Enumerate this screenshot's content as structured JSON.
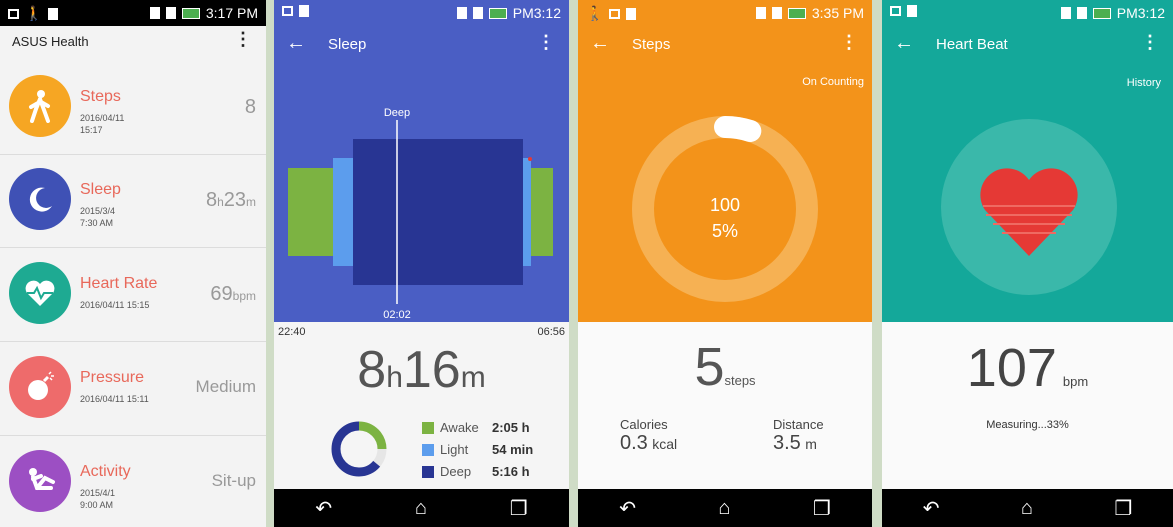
{
  "status": {
    "p1_time": "3:17 PM",
    "p2_time": "PM3:12",
    "p3_time": "3:35 PM",
    "p4_time": "PM3:12"
  },
  "home": {
    "title": "ASUS Health",
    "items": [
      {
        "name": "Steps",
        "date": "2016/04/11",
        "time": "15:17",
        "value": "8",
        "unit": "",
        "color": "#f6a623",
        "icon": "walking-icon"
      },
      {
        "name": "Sleep",
        "date": "2015/3/4",
        "time": "7:30 AM",
        "value": "8",
        "unit": "h",
        "value2": "23",
        "unit2": "m",
        "color": "#3f51b5",
        "icon": "moon-icon"
      },
      {
        "name": "Heart Rate",
        "date": "2016/04/11 15:15",
        "time": "",
        "value": "69",
        "unit": "bpm",
        "color": "#1eaa92",
        "icon": "heart-pulse-icon"
      },
      {
        "name": "Pressure",
        "date": "2016/04/11 15:11",
        "time": "",
        "value": "Medium",
        "unit": "",
        "color": "#ee6b6b",
        "icon": "bomb-icon"
      },
      {
        "name": "Activity",
        "date": "2015/4/1",
        "time": "9:00 AM",
        "value": "Sit-up",
        "unit": "",
        "color": "#9c4fc3",
        "icon": "situp-icon"
      }
    ]
  },
  "sleep": {
    "title": "Sleep",
    "marker_label": "Deep",
    "marker_time": "02:02",
    "start_time": "22:40",
    "end_time": "06:56",
    "total_hours": "8",
    "total_h_unit": "h",
    "total_minutes": "16",
    "total_m_unit": "m",
    "legend": [
      {
        "label": "Awake",
        "value": "2:05 h",
        "color": "#7cb342"
      },
      {
        "label": "Light",
        "value": "54 min",
        "color": "#5c9ded"
      },
      {
        "label": "Deep",
        "value": "5:16 h",
        "color": "#283593"
      }
    ],
    "donut": [
      {
        "label": "Awake",
        "fraction": 0.25,
        "color": "#7cb342"
      },
      {
        "label": "Light",
        "fraction": 0.11,
        "color": "#e6e6e6"
      },
      {
        "label": "Deep",
        "fraction": 0.64,
        "color": "#283593"
      }
    ]
  },
  "steps": {
    "title": "Steps",
    "status": "On Counting",
    "goal": "100",
    "percent": "5%",
    "progress": 0.05,
    "count": "5",
    "count_unit": "steps",
    "calories_label": "Calories",
    "calories_value": "0.3",
    "calories_unit": "kcal",
    "distance_label": "Distance",
    "distance_value": "3.5",
    "distance_unit": "m"
  },
  "heart": {
    "title": "Heart Beat",
    "history": "History",
    "bpm": "107",
    "bpm_unit": "bpm",
    "measuring": "Measuring...33%"
  }
}
